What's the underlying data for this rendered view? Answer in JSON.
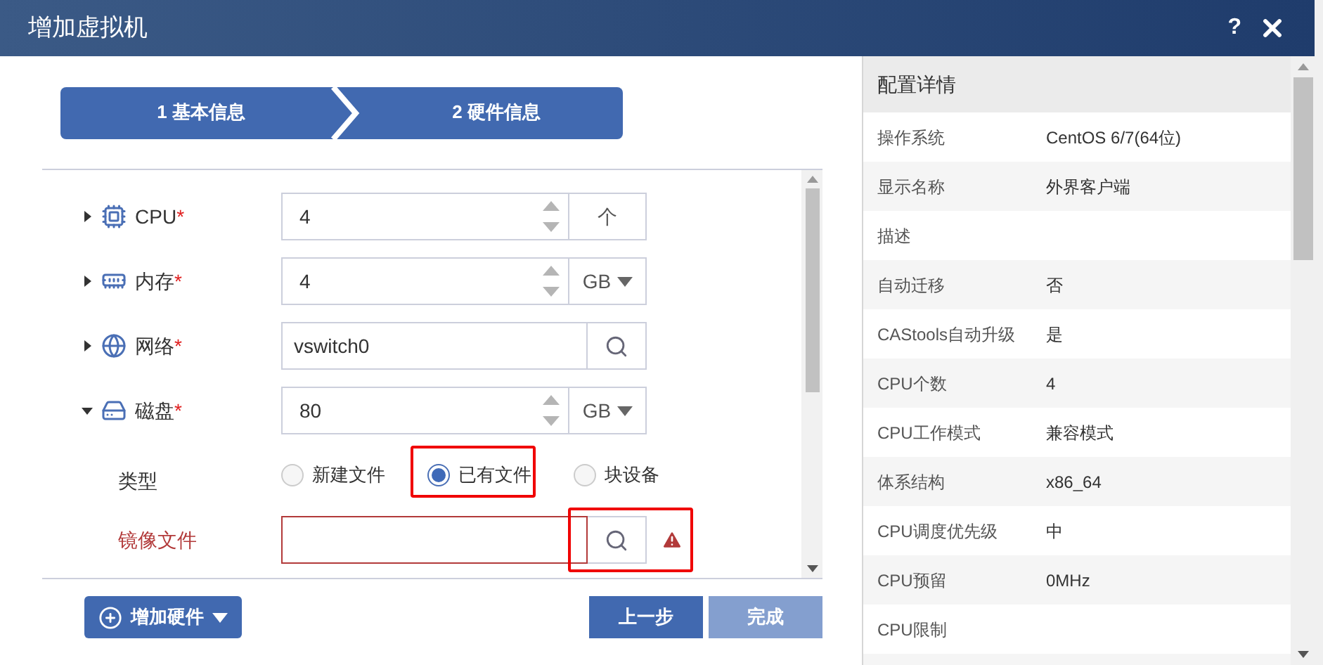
{
  "window": {
    "title": "增加虚拟机",
    "help": "?"
  },
  "steps": [
    "1 基本信息",
    "2 硬件信息"
  ],
  "hardware": [
    {
      "kind": "spinner",
      "label": "CPU",
      "required_mark": "*",
      "expanded": false,
      "value": "4",
      "unit": "个",
      "unit_dropdown": false
    },
    {
      "kind": "spinner",
      "label": "内存",
      "required_mark": "*",
      "expanded": false,
      "value": "4",
      "unit": "GB",
      "unit_dropdown": true
    },
    {
      "kind": "search",
      "label": "网络",
      "required_mark": "*",
      "expanded": false,
      "value": "vswitch0"
    },
    {
      "kind": "spinner",
      "label": "磁盘",
      "required_mark": "*",
      "expanded": true,
      "value": "80",
      "unit": "GB",
      "unit_dropdown": true
    },
    {
      "kind": "radio",
      "label": "类型",
      "options": [
        {
          "label": "新建文件",
          "selected": false
        },
        {
          "label": "已有文件",
          "selected": true
        },
        {
          "label": "块设备",
          "selected": false
        }
      ]
    },
    {
      "kind": "file",
      "label": "镜像文件",
      "error": true
    }
  ],
  "footer": {
    "add_hardware": "增加硬件",
    "prev": "上一步",
    "finish": {
      "label": "完成",
      "disabled": true
    }
  },
  "details": {
    "title": "配置详情",
    "rows": [
      {
        "label": "操作系统",
        "value": "CentOS 6/7(64位)"
      },
      {
        "label": "显示名称",
        "value": "外界客户端"
      },
      {
        "label": "描述"
      },
      {
        "label": "自动迁移",
        "value": "否"
      },
      {
        "label": "CAStools自动升级",
        "value": "是"
      },
      {
        "label": "CPU个数",
        "value": "4"
      },
      {
        "label": "CPU工作模式",
        "value": "兼容模式"
      },
      {
        "label": "体系结构",
        "value": "x86_64"
      },
      {
        "label": "CPU调度优先级",
        "value": "中"
      },
      {
        "label": "CPU预留",
        "value": "0MHz"
      },
      {
        "label": "CPU限制"
      }
    ]
  }
}
